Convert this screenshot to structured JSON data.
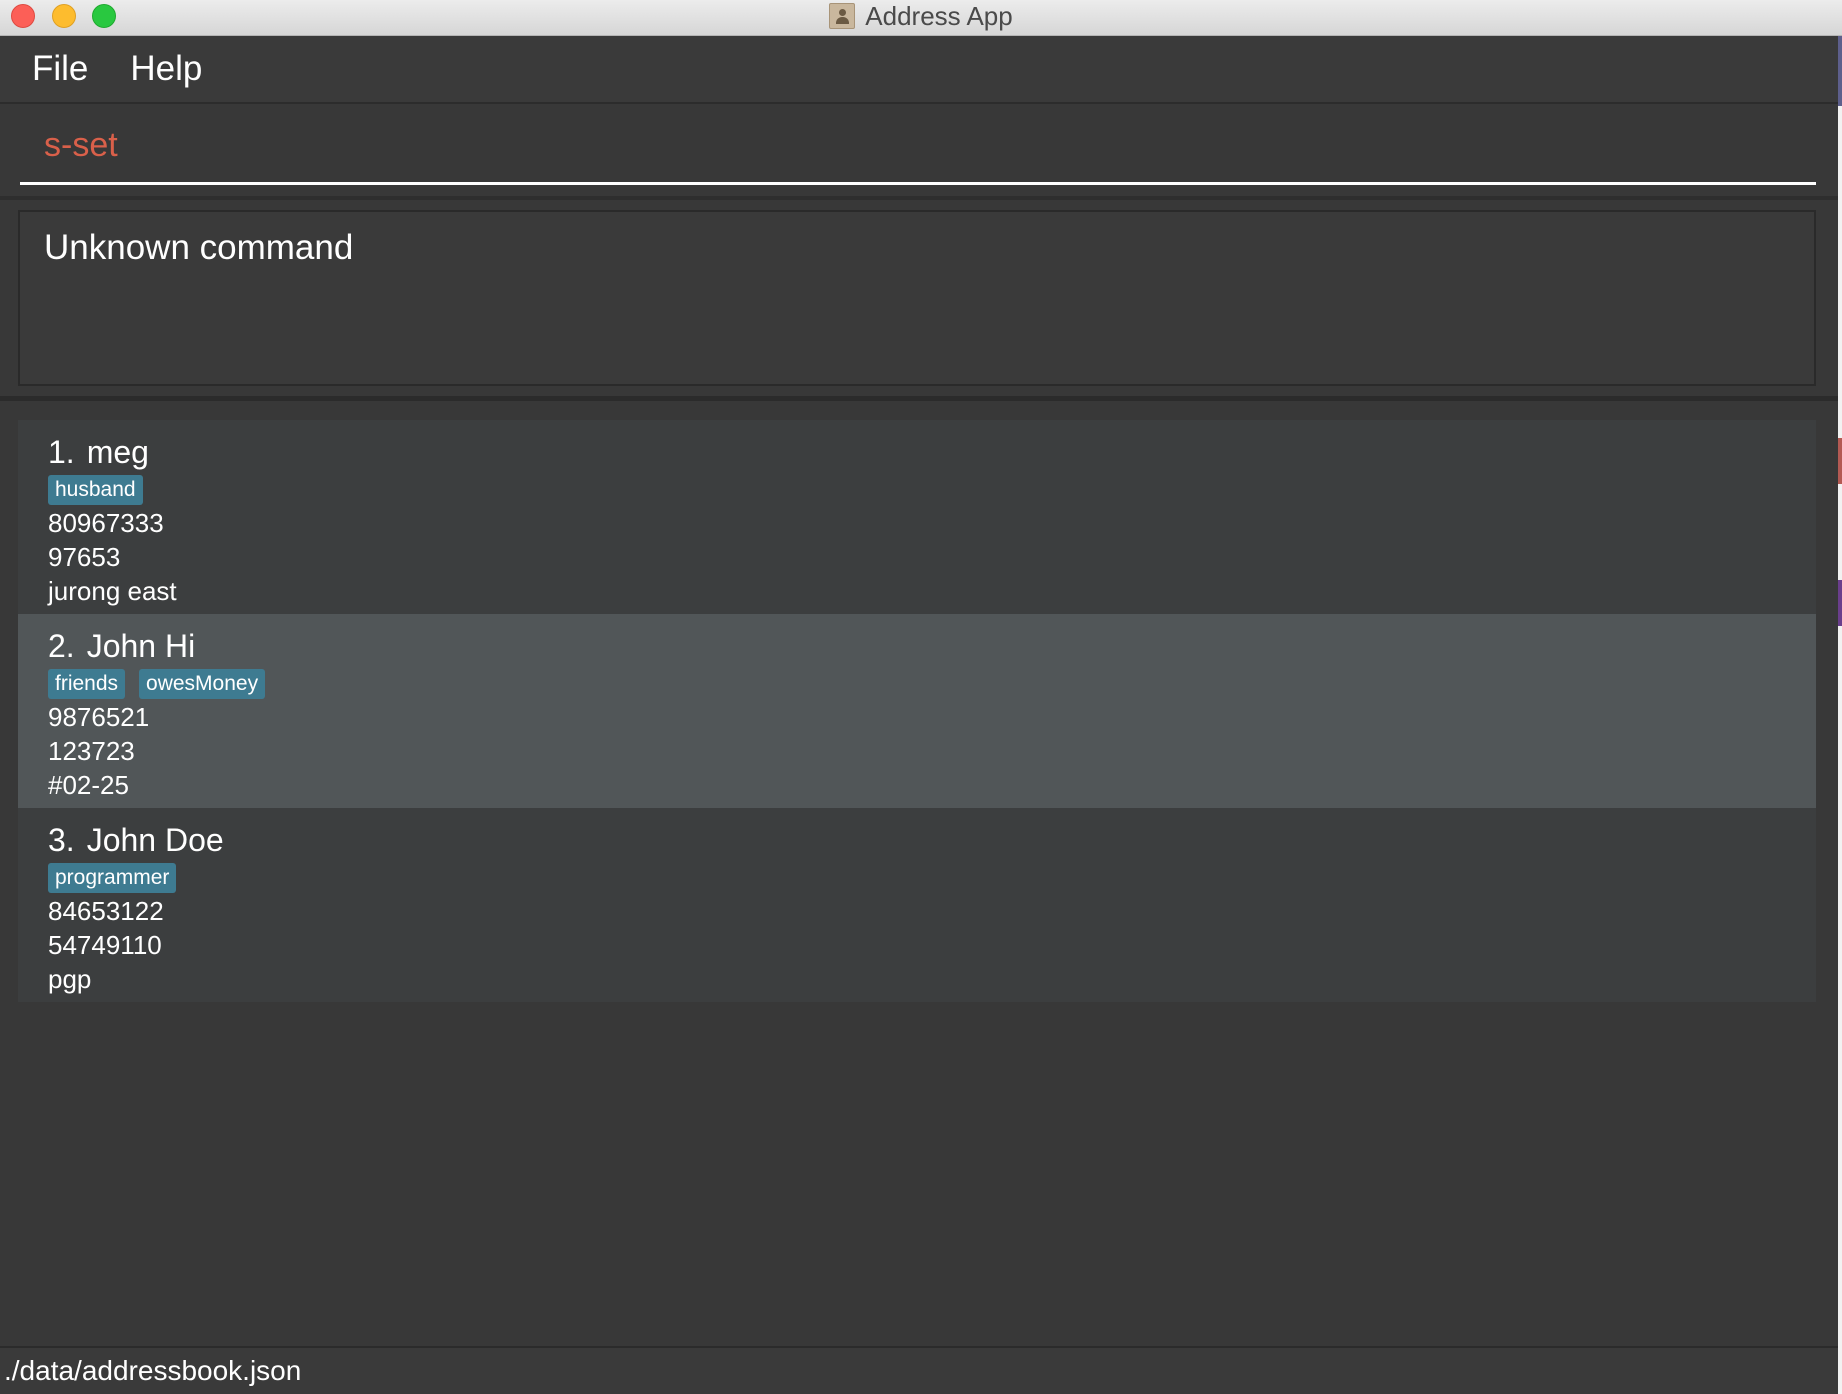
{
  "window": {
    "title": "Address App"
  },
  "menu": {
    "file": "File",
    "help": "Help"
  },
  "command": {
    "value": "s-set"
  },
  "result": {
    "message": "Unknown command"
  },
  "persons": [
    {
      "index": "1.",
      "name": "meg",
      "tags": [
        "husband"
      ],
      "phone": "80967333",
      "secondary": "97653",
      "address": "jurong east"
    },
    {
      "index": "2.",
      "name": "John Hi",
      "tags": [
        "friends",
        "owesMoney"
      ],
      "phone": "9876521",
      "secondary": "123723",
      "address": "#02-25"
    },
    {
      "index": "3.",
      "name": "John Doe",
      "tags": [
        "programmer"
      ],
      "phone": "84653122",
      "secondary": "54749110",
      "address": "pgp"
    }
  ],
  "status": {
    "file_path": "./data/addressbook.json"
  },
  "colors": {
    "background": "#383838",
    "command_text": "#d9604a",
    "tag": "#3e7b91",
    "selected_card": "#515658"
  }
}
